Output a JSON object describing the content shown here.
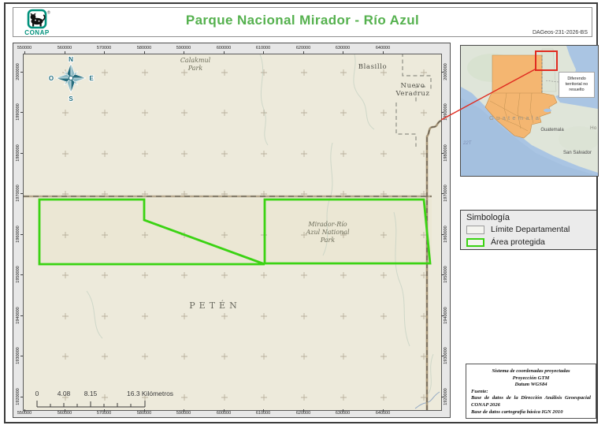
{
  "header": {
    "title": "Parque Nacional Mirador - Río Azul",
    "doc_id": "DAGeos-231-2026-BS",
    "logo": {
      "text": "CONAP",
      "reg": "®"
    }
  },
  "map": {
    "x_ticks": [
      "550000",
      "560000",
      "570000",
      "580000",
      "590000",
      "600000",
      "610000",
      "620000",
      "630000",
      "640000"
    ],
    "y_ticks": [
      "2000000",
      "1990000",
      "1980000",
      "1970000",
      "1960000",
      "1950000",
      "1940000",
      "1930000",
      "1920000"
    ],
    "places": {
      "calakmul": [
        "Calakmul",
        "Park"
      ],
      "blasillo": "Blasillo",
      "nuevo_veracruz": [
        "Nuevo",
        "Veracruz"
      ],
      "mirador": [
        "Mirador-Río",
        "Azul National",
        "Park"
      ],
      "peten": "PETÉN"
    },
    "compass": {
      "n": "N",
      "e": "E",
      "s": "S",
      "w": "O"
    },
    "scalebar": {
      "zero": "0",
      "quarter": "4.08",
      "half": "8.15",
      "full": "16.3 Kilómetros"
    }
  },
  "inset": {
    "country_label": "G u a t e m a l a",
    "city": "Guatemala",
    "san_salvador": "San Salvador",
    "honduras": "Ho",
    "grid_zone": "22T",
    "dispute_note": [
      "Diferendo",
      "territorial no",
      "resuelto"
    ]
  },
  "legend": {
    "title": "Simbología",
    "items": [
      {
        "label": "Límite Departamental",
        "swatch": "gray"
      },
      {
        "label": "Área protegida",
        "swatch": "green"
      }
    ]
  },
  "credits": {
    "crs": [
      "Sistema de coordenadas proyectadas",
      "Proyección GTM",
      "Datum WGS84"
    ],
    "fuente_label": "Fuente:",
    "sources": [
      "Base de datos de la Dirección Análisis Geoespacial CONAP 2026",
      "Base de datos cartografía básica IGN 2010"
    ]
  },
  "colors": {
    "title_green": "#55b14e",
    "conap_teal": "#00917c",
    "protected_green": "#3bd313",
    "dept_gray": "#9b9b9b",
    "dispute_red": "#e02b20",
    "map_bg": "#edeadb",
    "ocean_blue": "#aac5e3",
    "guatemala_orange": "#f4b671"
  }
}
